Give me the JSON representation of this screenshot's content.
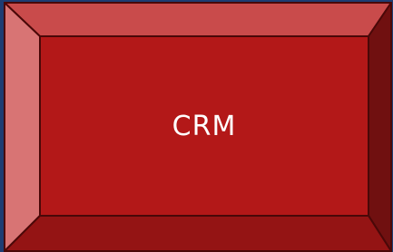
{
  "button": {
    "label": "CRM"
  },
  "colors": {
    "background": "#1e3d73",
    "face": "#b31818",
    "bevel_top": "#c94b4b",
    "bevel_left": "#d87474",
    "bevel_right": "#701010",
    "bevel_bottom": "#941414",
    "outline": "#4a0808",
    "text": "#ffffff"
  }
}
